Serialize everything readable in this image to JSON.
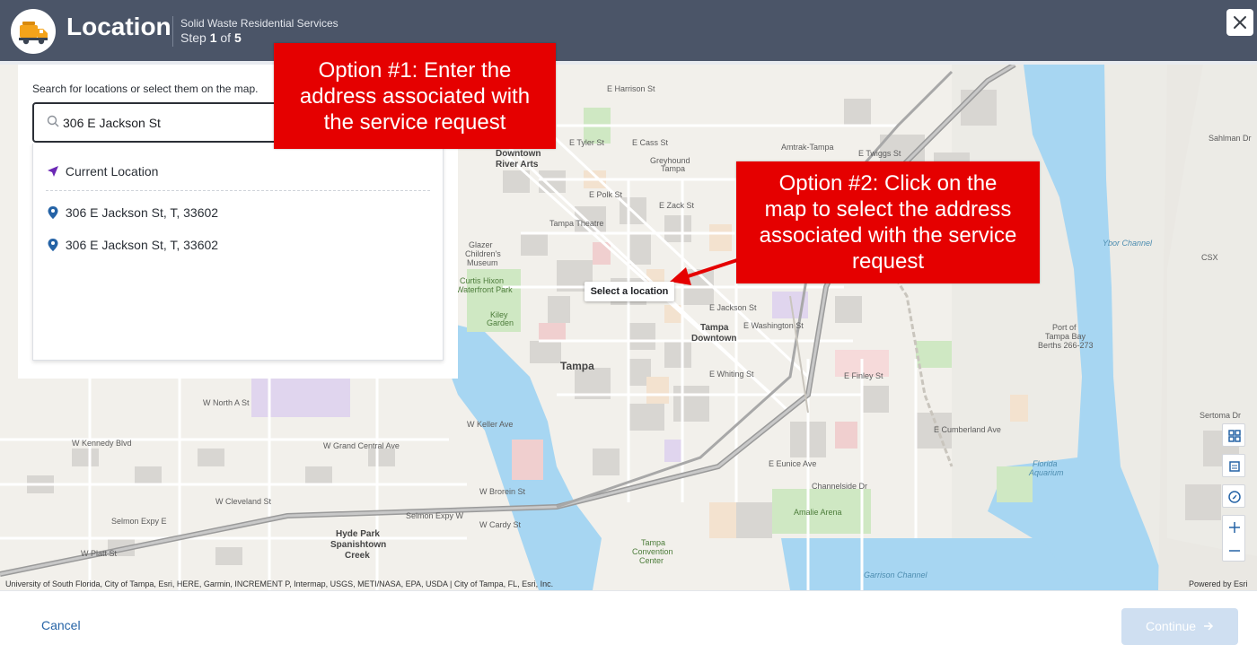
{
  "header": {
    "title": "Location",
    "service": "Solid Waste Residential Services",
    "step_word": "Step",
    "step_current": "1",
    "step_of": "of",
    "step_total": "5",
    "icons": {
      "logo": "garbage-truck-icon",
      "close": "close-icon"
    }
  },
  "panel": {
    "hint": "Search for locations or select them on the map.",
    "search_value": "306 E Jackson St",
    "current_location": "Current Location",
    "results": [
      "306 E Jackson St, T, 33602",
      "306 E Jackson St, T, 33602"
    ]
  },
  "callouts": {
    "option1_line1": "Option #1: Enter the",
    "option1_line2": "address associated with",
    "option1_line3": "the service request",
    "option2_line1": "Option #2: Click on the",
    "option2_line2": "map to select the address",
    "option2_line3": "associated with the service",
    "option2_line4": "request"
  },
  "map": {
    "tooltip": "Select a location",
    "attribution": "University of South Florida, City of Tampa, Esri, HERE, Garmin, INCREMENT P, Intermap, USGS, METI/NASA, EPA, USDA | City of Tampa, FL, Esri, Inc.",
    "powered_by": "Powered by Esri",
    "labels": {
      "downtown_river_arts_1": "Downtown",
      "downtown_river_arts_2": "River Arts",
      "tampa": "Tampa",
      "tampa_downtown_1": "Tampa",
      "tampa_downtown_2": "Downtown",
      "ybor_channel": "Ybor Channel",
      "e_jackson_st": "E Jackson St",
      "e_washington_st": "E Washington St",
      "e_whiting_st": "E Whiting St",
      "e_cumberland_ave": "E Cumberland Ave",
      "e_eunice_ave": "E Eunice Ave",
      "channelside_dr": "Channelside Dr",
      "w_kennedy_blvd": "W Kennedy Blvd",
      "w_grand_central_ave": "W Grand Central Ave",
      "w_cleveland_st": "W Cleveland St",
      "w_brorein_st": "W Brorein St",
      "w_cardy_st": "W Cardy St",
      "w_platt_st": "W Platt St",
      "w_north_a_st": "W North A St",
      "w_keller_ave": "W Keller Ave",
      "selmon_expy_1": "Selmon Expy E",
      "selmon_expy_2": "Selmon Expy W",
      "hyde_park_1": "Hyde Park",
      "hyde_park_2": "Spanishtown",
      "hyde_park_3": "Creek",
      "amalie_arena": "Amalie Arena",
      "florida_aquarium_1": "Florida",
      "florida_aquarium_2": "Aquarium",
      "tampa_convention_1": "Tampa",
      "tampa_convention_2": "Convention",
      "tampa_convention_3": "Center",
      "garrison_channel": "Garrison Channel",
      "kiley_garden_1": "Kiley",
      "kiley_garden_2": "Garden",
      "curtis_hixon_1": "Curtis Hixon",
      "curtis_hixon_2": "Waterfront Park",
      "glazer_1": "Glazer",
      "glazer_2": "Children's",
      "glazer_3": "Museum",
      "amtrak": "Amtrak-Tampa",
      "greyhound_1": "Greyhound",
      "greyhound_2": "Tampa",
      "tampa_theatre": "Tampa Theatre",
      "port_berths_1": "Port of",
      "port_berths_2": "Tampa Bay",
      "port_berths_3": "Berths 266-273",
      "e_finley_st": "E Finley St",
      "e_twiggs_st": "E Twiggs St",
      "e_zack_st": "E Zack St",
      "e_polk_st": "E Polk St",
      "e_cass_st": "E Cass St",
      "e_tyler_st": "E Tyler St",
      "e_harrison_st": "E Harrison St",
      "sahlman_dr": "Sahlman Dr",
      "csx": "CSX",
      "sertoma_dr": "Sertoma Dr"
    }
  },
  "footer": {
    "cancel": "Cancel",
    "continue": "Continue"
  },
  "colors": {
    "header_bg": "#4b5568",
    "callout_red": "#e50000",
    "link_blue": "#2563a6",
    "continue_disabled": "#cfdff1",
    "water": "#a7d6f2",
    "park": "#cfe8c3"
  }
}
